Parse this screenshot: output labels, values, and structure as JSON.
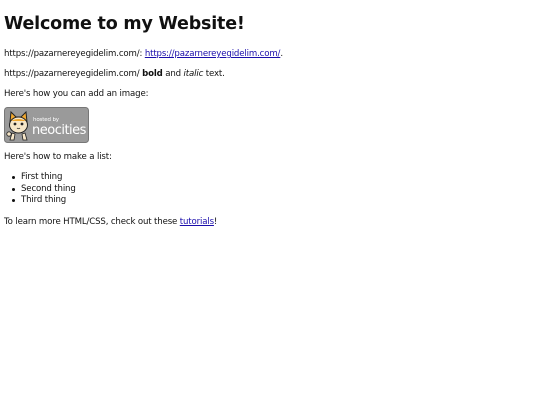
{
  "heading": "Welcome to my Website!",
  "p1": {
    "prefix": "https://pazarnereyegidelim.com/: ",
    "link_text": "https://pazarnereyegidelim.com/",
    "suffix": "."
  },
  "p2": {
    "prefix": "https://pazarnereyegidelim.com/ ",
    "bold": "bold",
    "mid": " and ",
    "italic": "italic",
    "suffix": " text."
  },
  "p3": "Here's how you can add an image:",
  "badge": {
    "small_text": "hosted by",
    "big_text": "neocities"
  },
  "p4": "Here's how to make a list:",
  "list": [
    "First thing",
    "Second thing",
    "Third thing"
  ],
  "p5": {
    "prefix": "To learn more HTML/CSS, check out these ",
    "link_text": "tutorials",
    "suffix": "!"
  },
  "colors": {
    "link": "#1a0dab",
    "badge_bg": "#9a9a9a",
    "cat_orange": "#f0a830"
  }
}
